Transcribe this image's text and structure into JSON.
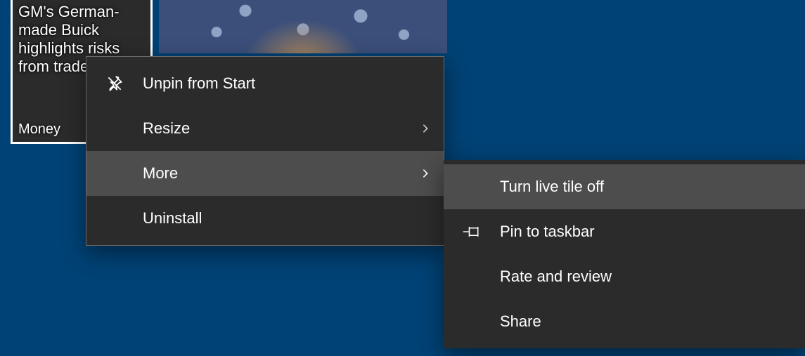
{
  "tiles": {
    "money": {
      "headline": "GM's German-made Buick highlights risks from trade war",
      "app_label": "Money"
    }
  },
  "context_menu": {
    "items": [
      {
        "label": "Unpin from Start",
        "icon": "unpin-icon",
        "submenu": false
      },
      {
        "label": "Resize",
        "icon": null,
        "submenu": true
      },
      {
        "label": "More",
        "icon": null,
        "submenu": true
      },
      {
        "label": "Uninstall",
        "icon": null,
        "submenu": false
      }
    ]
  },
  "more_submenu": {
    "items": [
      {
        "label": "Turn live tile off",
        "icon": null
      },
      {
        "label": "Pin to taskbar",
        "icon": "pin-icon"
      },
      {
        "label": "Rate and review",
        "icon": null
      },
      {
        "label": "Share",
        "icon": null
      }
    ]
  }
}
